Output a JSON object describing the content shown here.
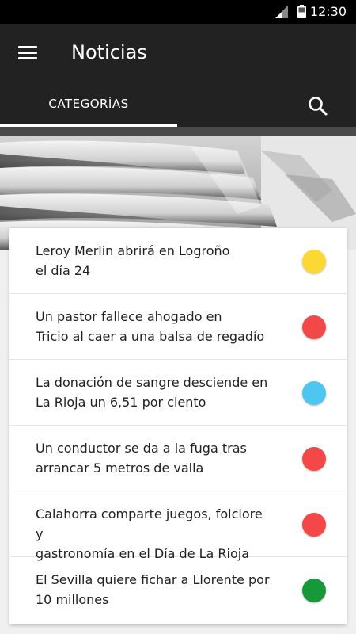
{
  "status_bar": {
    "time": "12:30",
    "icons": [
      "signal-icon",
      "battery-icon"
    ]
  },
  "app_bar": {
    "title": "Noticias",
    "menu_icon": "menu-icon",
    "search_icon": "search-icon"
  },
  "tabs": [
    {
      "label": "CATEGORÍAS",
      "selected": true
    }
  ],
  "hero": {
    "image": "newspapers-stack"
  },
  "news": [
    {
      "line1": "Leroy Merlin abrirá en Logroño",
      "line2": "el día 24",
      "color": "#fdd835"
    },
    {
      "line1": "Un pastor fallece ahogado en",
      "line2": "Tricio al caer a una balsa de regadío",
      "color": "#f44848"
    },
    {
      "line1": "La donación de sangre desciende en",
      "line2": "La Rioja un 6,51 por ciento",
      "color": "#4fc6ef"
    },
    {
      "line1": "Un conductor se da a la fuga tras",
      "line2": "arrancar 5 metros de valla",
      "color": "#f44848"
    },
    {
      "line1": "Calahorra comparte juegos, folclore y",
      "line2": "gastronomía en el Día de La Rioja",
      "color": "#f44848"
    },
    {
      "line1": "El Sevilla quiere fichar a Llorente por",
      "line2": "10 millones",
      "color": "#17993a"
    }
  ]
}
